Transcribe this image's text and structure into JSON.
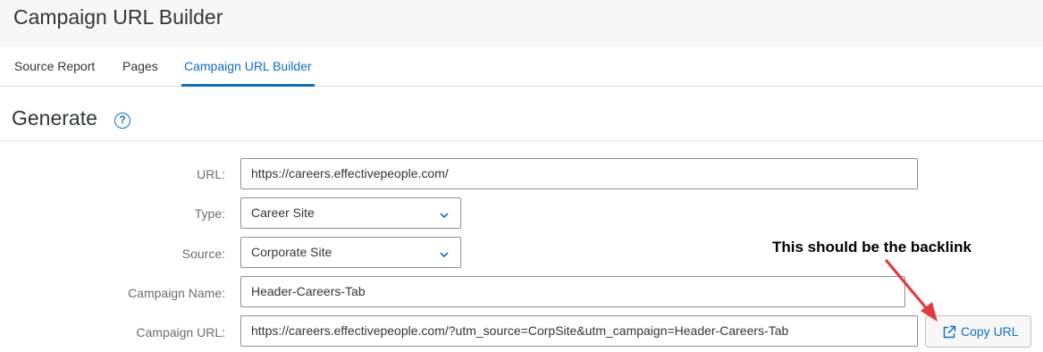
{
  "header": {
    "title": "Campaign URL Builder"
  },
  "tabs": [
    {
      "label": "Source Report",
      "active": false
    },
    {
      "label": "Pages",
      "active": false
    },
    {
      "label": "Campaign URL Builder",
      "active": true
    }
  ],
  "section": {
    "title": "Generate",
    "help_icon": "question-mark-circle"
  },
  "form": {
    "url": {
      "label": "URL:",
      "value": "https://careers.effectivepeople.com/"
    },
    "type": {
      "label": "Type:",
      "value": "Career Site"
    },
    "source": {
      "label": "Source:",
      "value": "Corporate Site"
    },
    "campaign_name": {
      "label": "Campaign Name:",
      "value": "Header-Careers-Tab"
    },
    "campaign_url": {
      "label": "Campaign URL:",
      "value": "https://careers.effectivepeople.com/?utm_source=CorpSite&utm_campaign=Header-Careers-Tab"
    },
    "copy_button": {
      "label": "Copy URL",
      "icon": "external-link-icon"
    }
  },
  "annotation": {
    "text": "This should be the backlink",
    "color": "#e03c3c"
  },
  "colors": {
    "accent": "#0a6ed1",
    "header_bg": "#f7f7f7",
    "text": "#32363a",
    "label": "#6a6d70"
  }
}
